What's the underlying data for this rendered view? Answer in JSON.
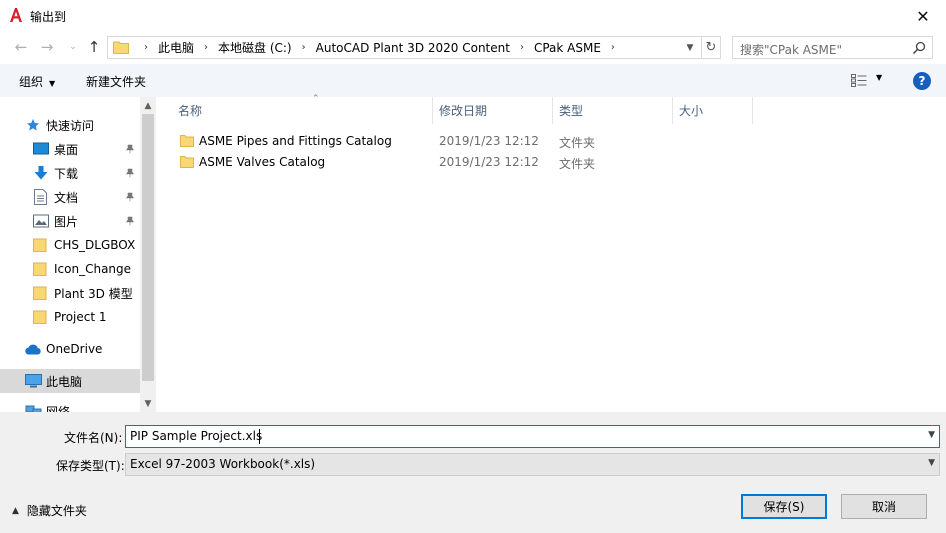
{
  "window": {
    "title": "输出到",
    "close_glyph": "✕"
  },
  "address": {
    "crumbs": [
      "此电脑",
      "本地磁盘 (C:)",
      "AutoCAD Plant 3D 2020 Content",
      "CPak ASME"
    ],
    "separator": "›",
    "search_placeholder": "搜索\"CPak ASME\""
  },
  "toolbar": {
    "organize": "组织",
    "new_folder": "新建文件夹",
    "help": "?"
  },
  "nav": {
    "quick_access": "快速访问",
    "items": [
      {
        "label": "桌面",
        "pinned": true
      },
      {
        "label": "下载",
        "pinned": true
      },
      {
        "label": "文档",
        "pinned": true
      },
      {
        "label": "图片",
        "pinned": true
      },
      {
        "label": "CHS_DLGBOX",
        "pinned": false
      },
      {
        "label": "Icon_Change",
        "pinned": false
      },
      {
        "label": "Plant 3D 模型",
        "pinned": false
      },
      {
        "label": "Project 1",
        "pinned": false
      }
    ],
    "onedrive": "OneDrive",
    "this_pc": "此电脑",
    "network": "网络"
  },
  "columns": {
    "name": "名称",
    "date": "修改日期",
    "type": "类型",
    "size": "大小"
  },
  "files": [
    {
      "name": "ASME Pipes and Fittings Catalog",
      "date": "2019/1/23 12:12",
      "type": "文件夹"
    },
    {
      "name": "ASME Valves Catalog",
      "date": "2019/1/23 12:12",
      "type": "文件夹"
    }
  ],
  "form": {
    "filename_label": "文件名(N):",
    "filename_value": "PIP Sample Project.xls",
    "filetype_label": "保存类型(T):",
    "filetype_value": "Excel 97-2003 Workbook(*.xls)",
    "hide_folders": "隐藏文件夹",
    "save": "保存(S)",
    "cancel": "取消"
  },
  "colors": {
    "accent": "#0078d7",
    "folder": "#f8d775",
    "toolbar_bg": "#f2f5f9",
    "selected_bg": "#d9d9d9"
  }
}
